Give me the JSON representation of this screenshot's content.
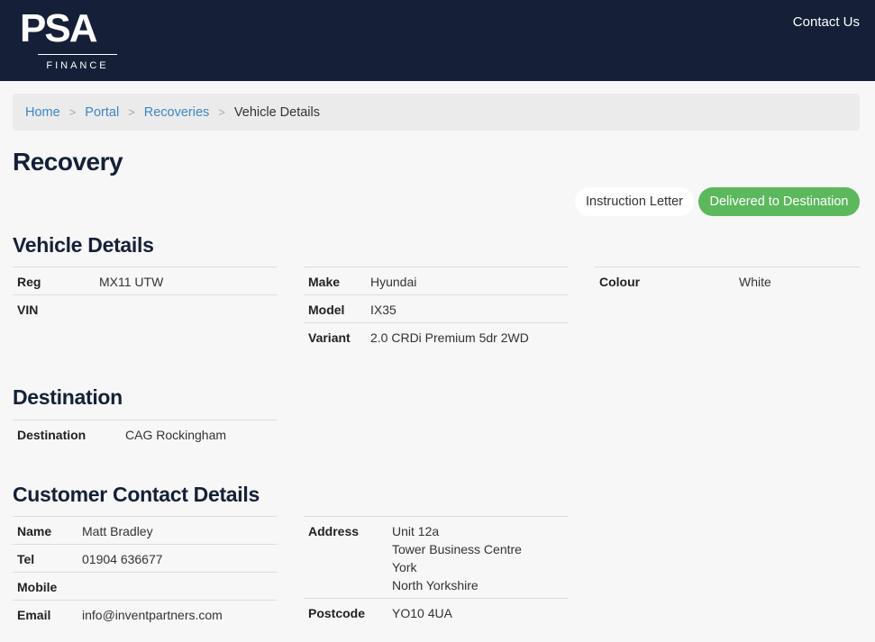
{
  "header": {
    "logo_main": "PSA",
    "logo_sub": "FINANCE",
    "contact_label": "Contact Us"
  },
  "breadcrumb": {
    "items": [
      "Home",
      "Portal",
      "Recoveries"
    ],
    "separator": ">",
    "current": "Vehicle Details"
  },
  "page_title": "Recovery",
  "actions": {
    "instruction_letter": "Instruction Letter",
    "status": "Delivered to Destination"
  },
  "vehicle": {
    "heading": "Vehicle Details",
    "reg_label": "Reg",
    "reg": "MX11 UTW",
    "vin_label": "VIN",
    "vin": "",
    "make_label": "Make",
    "make": "Hyundai",
    "model_label": "Model",
    "model": "IX35",
    "variant_label": "Variant",
    "variant": "2.0 CRDi Premium 5dr 2WD",
    "colour_label": "Colour",
    "colour": "White"
  },
  "destination": {
    "heading": "Destination",
    "label": "Destination",
    "value": "CAG Rockingham"
  },
  "customer": {
    "heading": "Customer Contact Details",
    "name_label": "Name",
    "name": "Matt Bradley",
    "tel_label": "Tel",
    "tel": "01904 636677",
    "mobile_label": "Mobile",
    "mobile": "",
    "email_label": "Email",
    "email": "info@inventpartners.com",
    "address_label": "Address",
    "address_lines": [
      "Unit 12a",
      "Tower Business Centre",
      "York",
      "North Yorkshire"
    ],
    "postcode_label": "Postcode",
    "postcode": "YO10 4UA"
  },
  "colors": {
    "navbar": "#152038",
    "link": "#3b86c6",
    "status_green": "#5cb85c",
    "page_bg": "#f7f7f7"
  }
}
